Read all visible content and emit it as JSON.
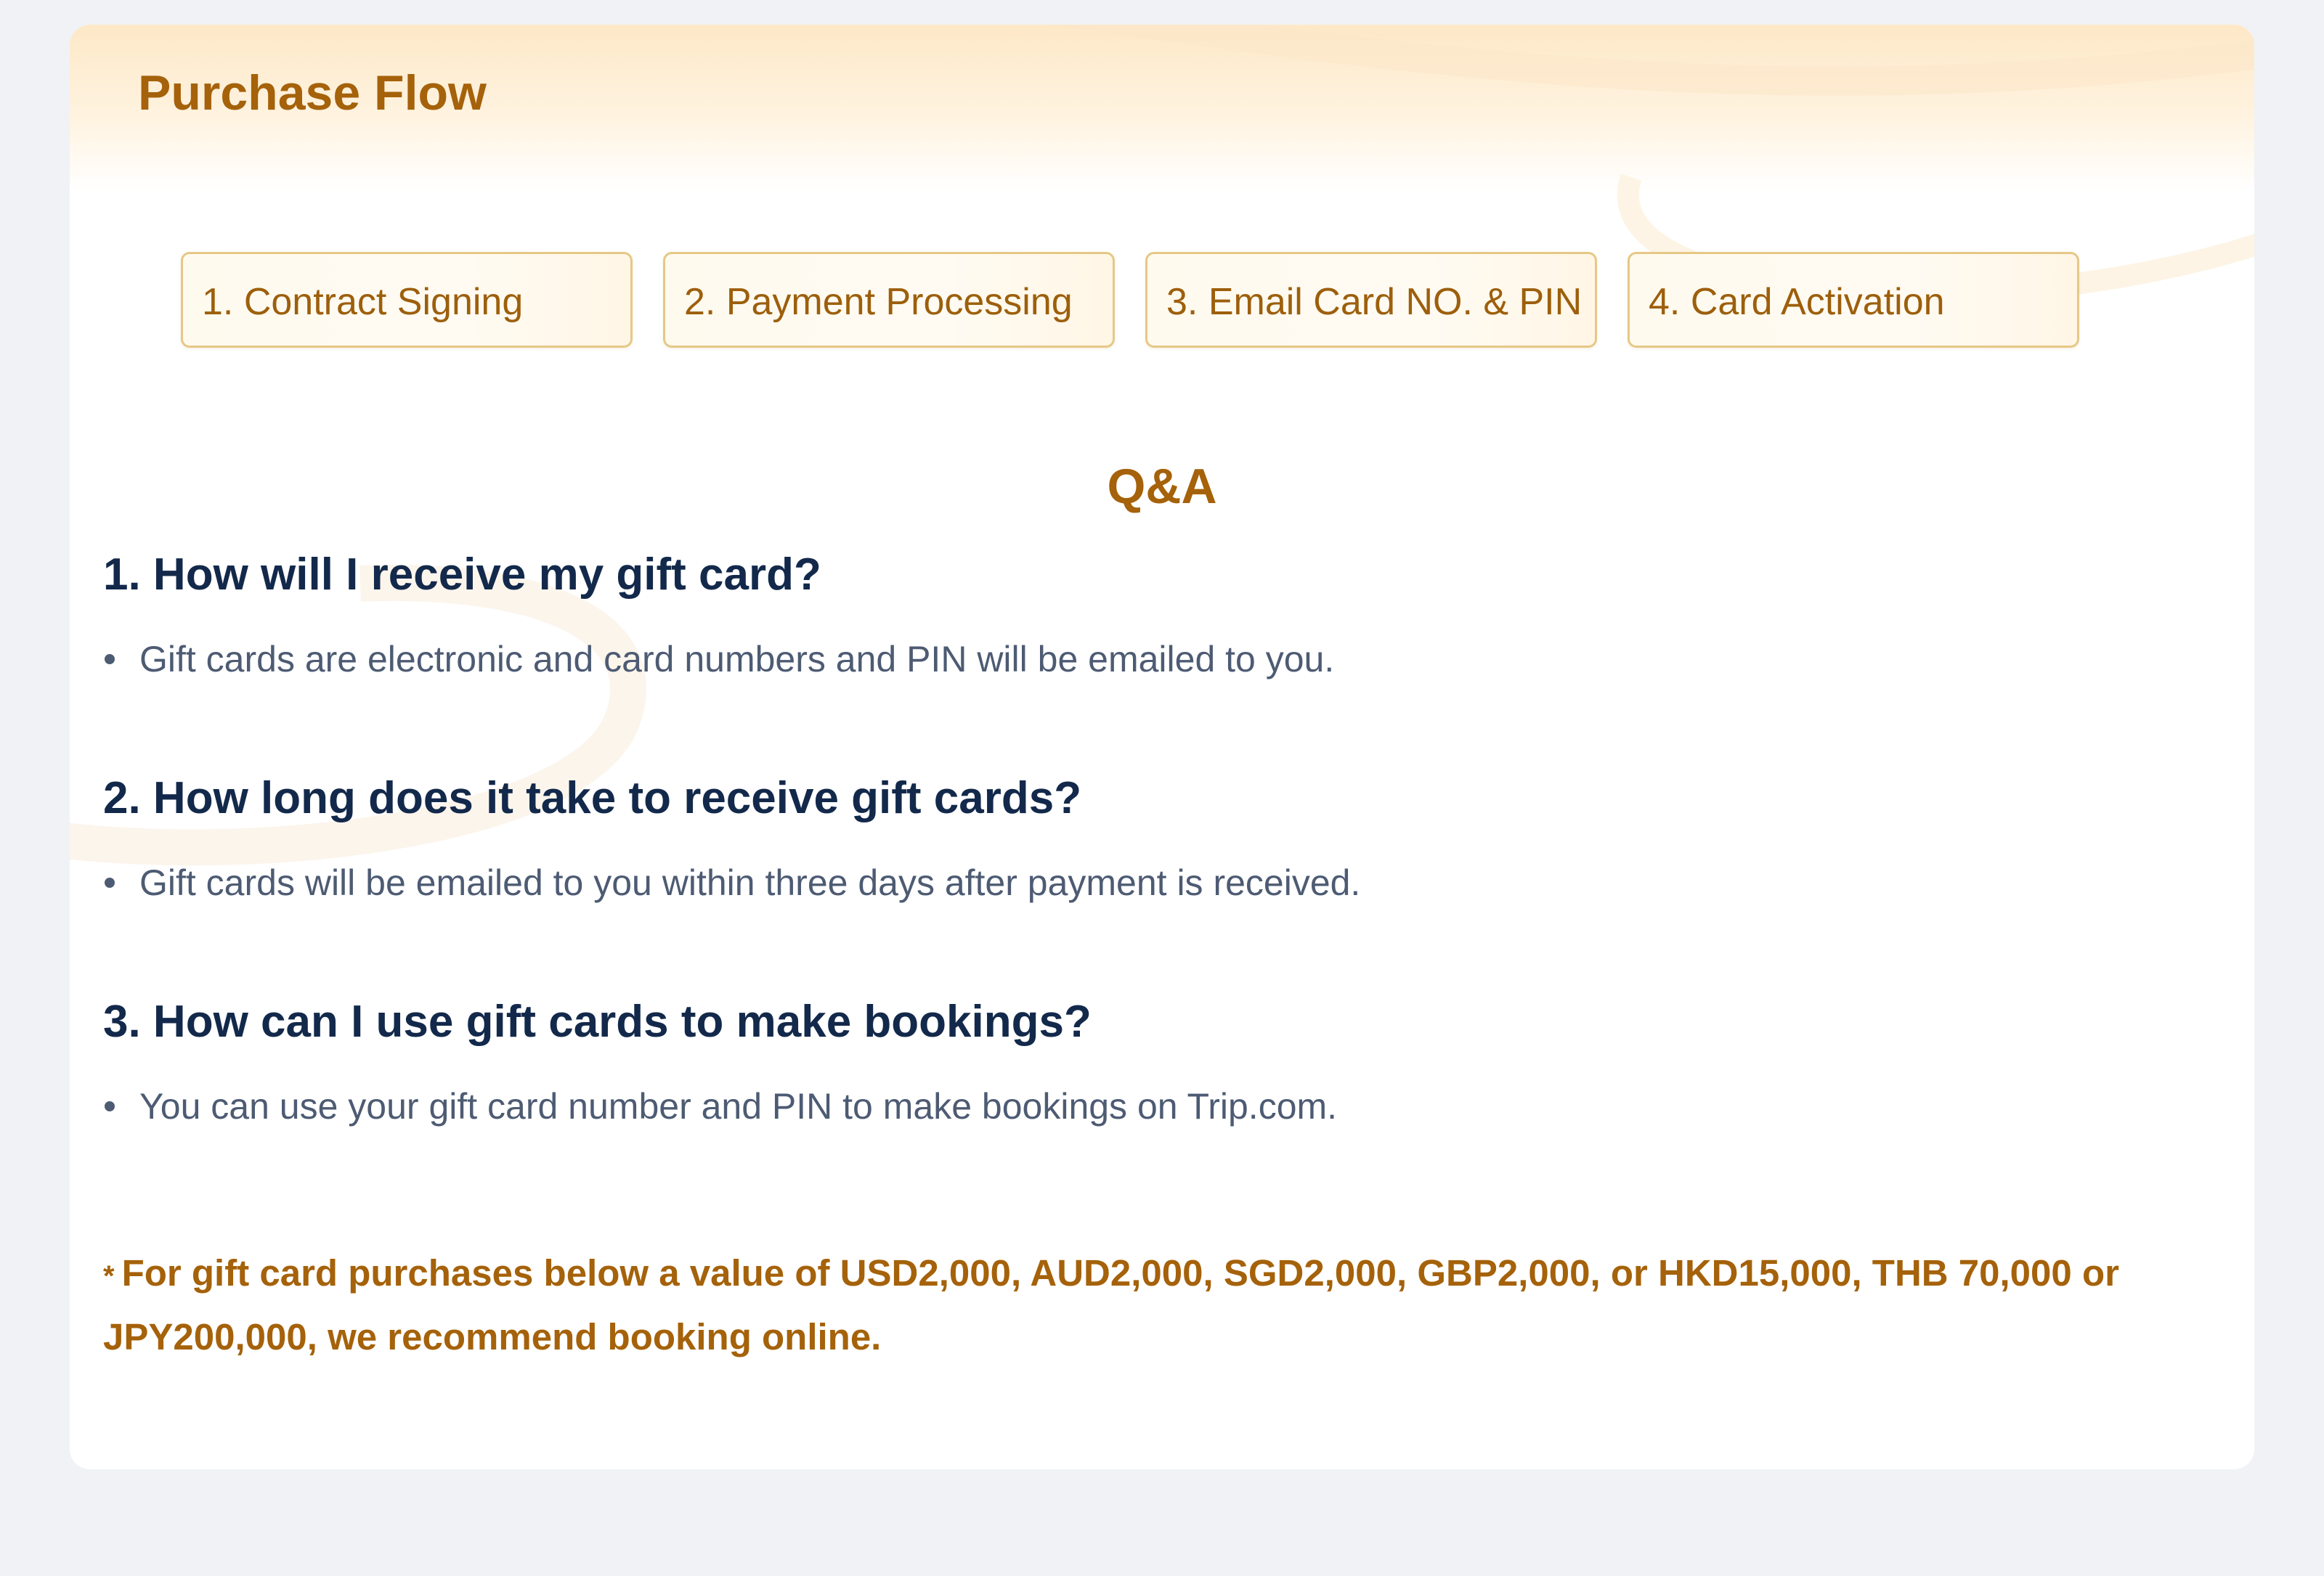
{
  "section": {
    "title": "Purchase Flow"
  },
  "steps": [
    {
      "label": "1. Contract Signing"
    },
    {
      "label": "2. Payment Processing"
    },
    {
      "label": "3. Email Card NO. & PIN"
    },
    {
      "label": "4. Card Activation"
    }
  ],
  "qa": {
    "title": "Q&A",
    "items": [
      {
        "question": "1. How will I receive my gift card?",
        "answer": "Gift cards are electronic and card numbers and PIN will be emailed to you."
      },
      {
        "question": "2. How long does it take to receive gift cards?",
        "answer": "Gift cards will be emailed to you within three days after payment is received."
      },
      {
        "question": "3. How can I use gift cards to make bookings?",
        "answer": "You can use your gift card number and PIN to make bookings on Trip.com."
      }
    ]
  },
  "note": {
    "marker": "*",
    "text": "For gift card purchases below a value of USD2,000, AUD2,000, SGD2,000, GBP2,000, or HKD15,000, THB 70,000 or JPY200,000, we recommend booking online."
  },
  "colors": {
    "page_background": "#f0f2f6",
    "card_background": "#ffffff",
    "accent_gold": "#a5620a",
    "step_border": "#e6c886",
    "question_text": "#13294b",
    "answer_text": "#4d5b73"
  }
}
